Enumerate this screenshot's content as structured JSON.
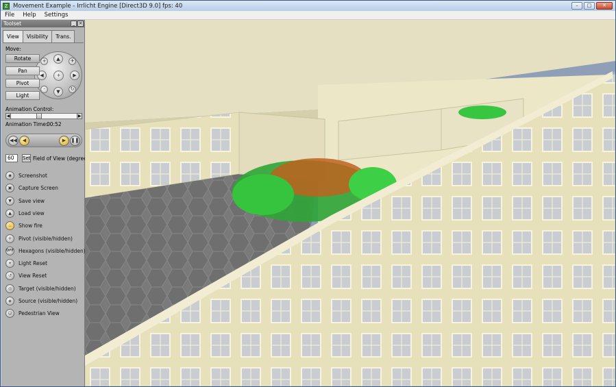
{
  "window": {
    "title": "Movement Example - Irrlicht Engine [Direct3D 9.0] fps: 40",
    "controls": {
      "minimize": "–",
      "maximize": "□",
      "close": "✕"
    }
  },
  "menu": [
    "File",
    "Help",
    "Settings"
  ],
  "toolset": {
    "title": "Toolset",
    "tabs": [
      "View",
      "Visibility",
      "Trans."
    ],
    "active_tab": "View",
    "move_label": "Move:",
    "move_buttons": [
      "Rotate",
      "Pan",
      "Pivot",
      "Light"
    ],
    "animation_control_label": "Animation Control:",
    "animation_time_label": "Animation Time:",
    "animation_time_value": "00:52",
    "field_of_view": {
      "value": "60",
      "set_label": "Set",
      "label": "Field of View (degree)"
    },
    "commands": [
      {
        "label": "Screenshot",
        "icon": "camera-icon"
      },
      {
        "label": "Capture Screen",
        "icon": "capture-icon"
      },
      {
        "label": "Save view",
        "icon": "save-icon"
      },
      {
        "label": "Load view",
        "icon": "load-icon"
      },
      {
        "label": "Show fire",
        "icon": "fire-icon"
      },
      {
        "label": "Pivot (visible/hidden)",
        "icon": "pivot-icon"
      },
      {
        "label": "Hexagons (visible/hidden)",
        "icon": "off-icon",
        "glyph": "OFF"
      },
      {
        "label": "Light Reset",
        "icon": "light-icon"
      },
      {
        "label": "View Reset",
        "icon": "view-reset-icon"
      },
      {
        "label": "Target (visible/hidden)",
        "icon": "target-icon"
      },
      {
        "label": "Source (visible/hidden)",
        "icon": "source-icon"
      },
      {
        "label": "Pedestrian View",
        "icon": "pedestrian-icon"
      }
    ]
  },
  "colors": {
    "pedestrian_green": "#22c52c",
    "pedestrian_red": "#b8521a",
    "wall": "#ece8c4",
    "floor": "#777777"
  }
}
